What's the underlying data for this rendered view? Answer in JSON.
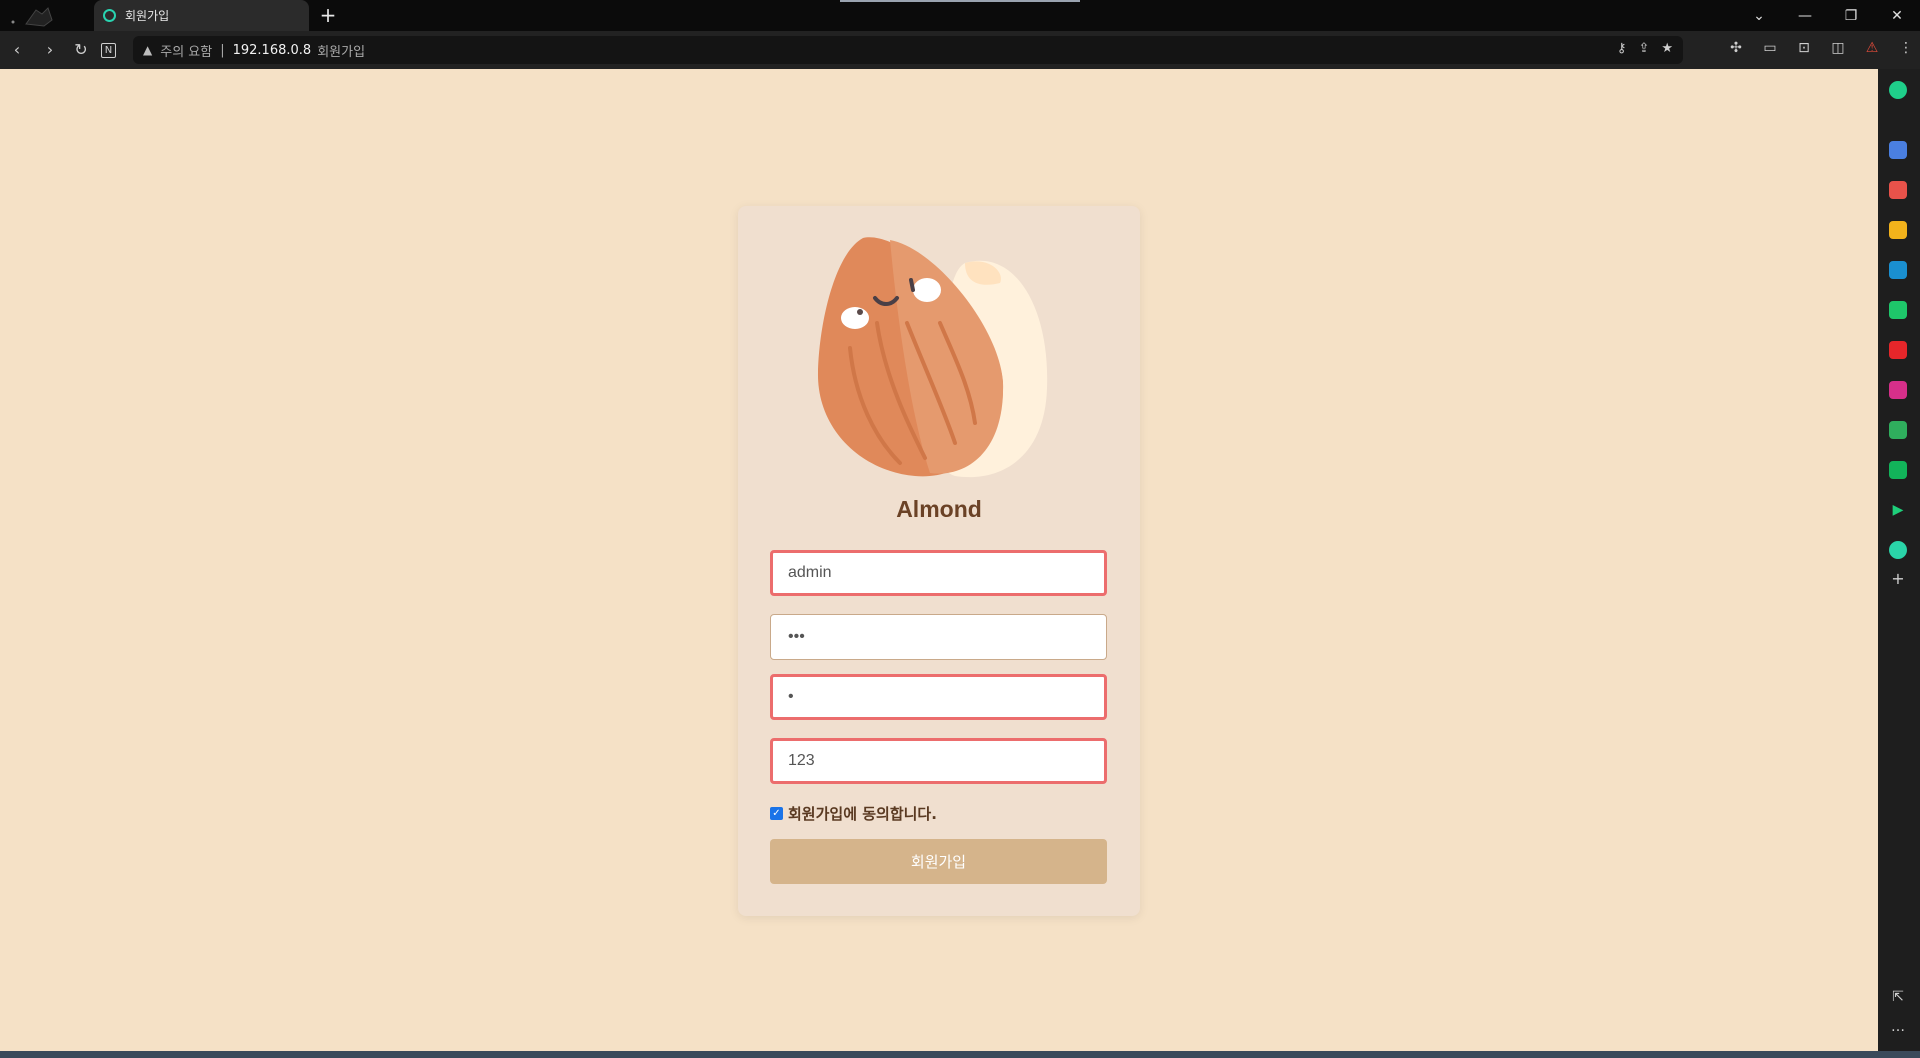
{
  "browser": {
    "tab_title": "회원가입",
    "new_tab_icon": "plus-icon",
    "address": {
      "security_text": "주의 요함",
      "separator": "|",
      "host": "192.168.0.8",
      "path_title": "회원가입"
    }
  },
  "page": {
    "brand": "Almond",
    "form": {
      "username_value": "admin",
      "password_value": "•••",
      "password_confirm_value": "•",
      "extra_value": "123",
      "agree_checked": true,
      "agree_label": "회원가입에 동의합니다.",
      "submit_label": "회원가입"
    }
  },
  "colors": {
    "page_bg": "#f5e1c6",
    "card_bg": "#f0dfcf",
    "error_border": "#ec6d6d",
    "button_bg": "#d5b48b",
    "brand_text": "#6b4226"
  }
}
